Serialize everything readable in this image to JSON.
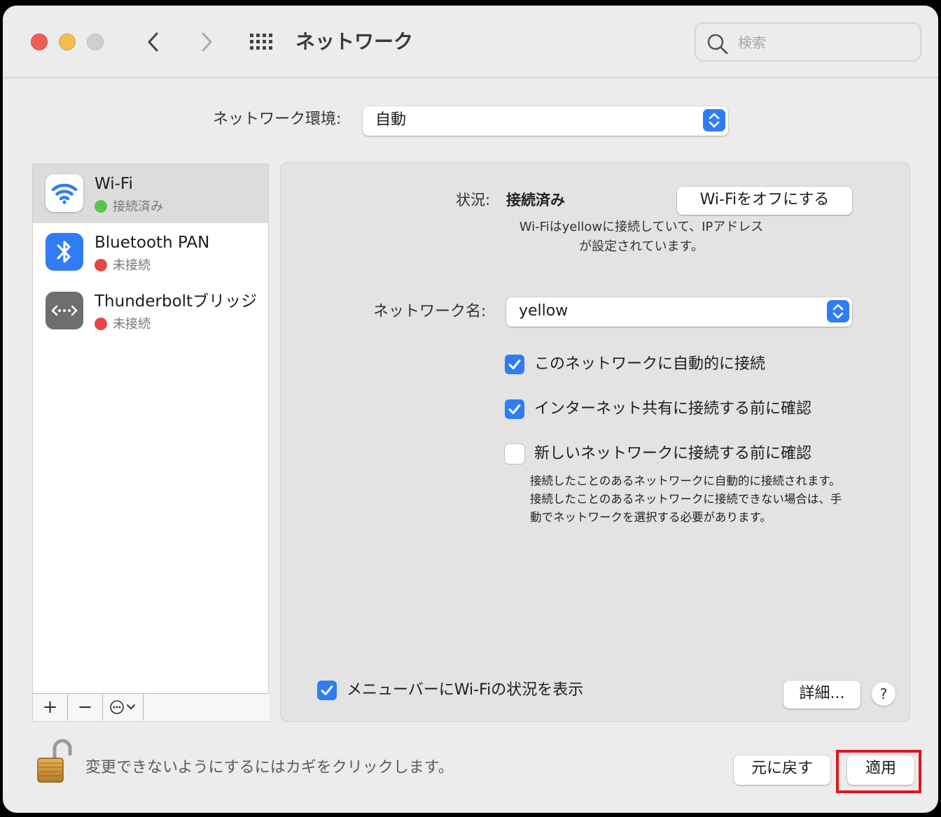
{
  "window": {
    "title": "ネットワーク",
    "search_placeholder": "検索"
  },
  "location": {
    "label": "ネットワーク環境:",
    "value": "自動"
  },
  "services": [
    {
      "name": "Wi-Fi",
      "status": "接続済み",
      "status_color": "#5ac44e",
      "icon": "wifi-icon",
      "selected": true
    },
    {
      "name": "Bluetooth PAN",
      "status": "未接続",
      "status_color": "#e4474a",
      "icon": "bluetooth-icon",
      "selected": false
    },
    {
      "name": "Thunderboltブリッジ",
      "status": "未接続",
      "status_color": "#e4474a",
      "icon": "thunderbolt-bridge-icon",
      "selected": false
    }
  ],
  "sidebar_tools": {
    "add": "+",
    "remove": "−"
  },
  "detail": {
    "status_label": "状況:",
    "status_value": "接続済み",
    "wifi_off_button": "Wi-Fiをオフにする",
    "status_desc_line1": "Wi-Fiはyellowに接続していて、IPアドレス",
    "status_desc_line2": "が設定されています。",
    "network_name_label": "ネットワーク名:",
    "network_name_value": "yellow",
    "options": [
      {
        "label": "このネットワークに自動的に接続",
        "checked": true
      },
      {
        "label": "インターネット共有に接続する前に確認",
        "checked": true
      },
      {
        "label": "新しいネットワークに接続する前に確認",
        "checked": false
      }
    ],
    "hint": "接続したことのあるネットワークに自動的に接続されます。接続したことのあるネットワークに接続できない場合は、手動でネットワークを選択する必要があります。",
    "menubar_label": "メニューバーにWi-Fiの状況を表示",
    "menubar_checked": true,
    "advanced_button": "詳細...",
    "help_button": "?"
  },
  "footer": {
    "lock_text": "変更できないようにするにはカギをクリックします。",
    "revert_button": "元に戻す",
    "apply_button": "適用"
  },
  "colors": {
    "accent": "#2f7cf6",
    "highlight": "#e0161c"
  }
}
